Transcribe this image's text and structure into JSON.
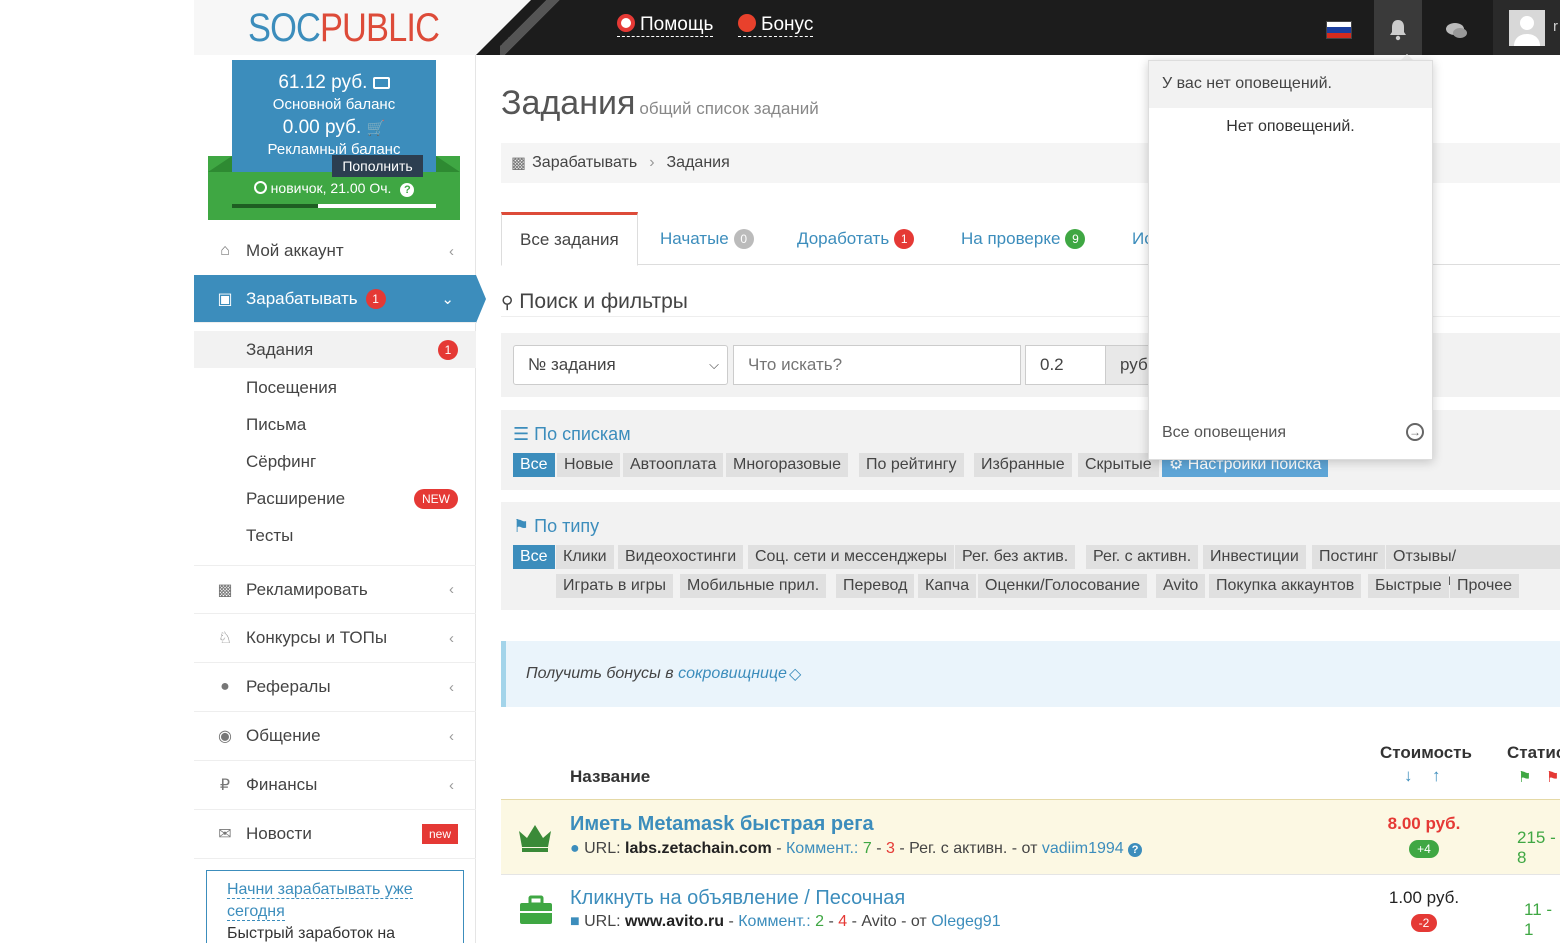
{
  "header": {
    "logo_left": "SOC",
    "logo_right": "PUBLIC",
    "help_label": "Помощь",
    "bonus_label": "Бонус",
    "user_initial": "r"
  },
  "balance": {
    "main_amount": "61.12 руб.",
    "main_label": "Основной баланс",
    "ad_amount": "0.00 руб.",
    "ad_label": "Рекламный баланс",
    "topup_label": "Пополнить",
    "level_text": "новичок, 21.00 Оч.",
    "level_progress": 0.42
  },
  "sidebar": {
    "account": "Мой аккаунт",
    "earn": "Зарабатывать",
    "earn_badge": "1",
    "sub": [
      {
        "label": "Задания",
        "badge": "1"
      },
      {
        "label": "Посещения"
      },
      {
        "label": "Письма"
      },
      {
        "label": "Сёрфинг"
      },
      {
        "label": "Расширение",
        "badge": "NEW"
      },
      {
        "label": "Тесты"
      }
    ],
    "advertise": "Рекламировать",
    "contests": "Конкурсы и ТОПы",
    "referrals": "Рефералы",
    "chat": "Общение",
    "finance": "Финансы",
    "news": "Новости",
    "news_badge": "new",
    "promo_link": "Начни зарабатывать уже сегодня",
    "promo_text": "Быстрый заработок на"
  },
  "page": {
    "title": "Задания",
    "subtitle": "общий список заданий",
    "crumb_1": "Зарабатывать",
    "crumb_2": "Задания"
  },
  "tabs": [
    {
      "label": "Все задания"
    },
    {
      "label": "Начатые",
      "count": "0"
    },
    {
      "label": "Доработать",
      "count": "1"
    },
    {
      "label": "На проверке",
      "count": "9"
    },
    {
      "label": "Ис"
    }
  ],
  "filters": {
    "title": "Поиск и фильтры",
    "select_value": "№ задания",
    "search_placeholder": "Что искать?",
    "min_price": "0.2",
    "currency": "руб",
    "lists_title": "По спискам",
    "lists": [
      "Все",
      "Новые",
      "Автооплата",
      "Многоразовые",
      "По рейтингу",
      "Избранные",
      "Скрытые",
      "Настройки поиска"
    ],
    "types_title": "По типу",
    "types_row1": [
      "Все",
      "Клики",
      "Видеохостинги",
      "Соц. сети и мессенджеры",
      "Рег. без актив.",
      "Рег. с активн.",
      "Инвестиции",
      "Постинг",
      "Отзывы/Комментарии"
    ],
    "types_row2": [
      "Играть в игры",
      "Мобильные прил.",
      "Перевод",
      "Капча",
      "Оценки/Голосование",
      "Avito",
      "Покупка аккаунтов",
      "Быстрые",
      "Прочее"
    ]
  },
  "callout": {
    "text": "Получить бонусы в",
    "link": "сокровищнице"
  },
  "table": {
    "col_name": "Название",
    "col_cost": "Стоимость",
    "col_stat": "Статис",
    "rows": [
      {
        "title": "Иметь Metamask быстрая рега",
        "url_label": "URL:",
        "url": "labs.zetachain.com",
        "comm_label": "Коммент.:",
        "comm_pos": "7",
        "dash": "-",
        "comm_neg": "3",
        "category": "- Рег. с активн. - от",
        "author": "vadiim1994",
        "price": "8.00 руб.",
        "delta": "+4",
        "stat": "215 - 8"
      },
      {
        "title": "Кликнуть на объявление / Песочная",
        "url_label": "URL:",
        "url": "www.avito.ru",
        "comm_label": "Коммент.:",
        "comm_pos": "2",
        "dash": "-",
        "comm_neg": "4",
        "category": "- Avito - от",
        "author": "Olegeg91",
        "price": "1.00 руб.",
        "delta": "-2",
        "stat": "11 - 1"
      }
    ]
  },
  "notifications": {
    "header": "У вас нет оповещений.",
    "empty": "Нет оповещений.",
    "all_link": "Все оповещения"
  },
  "colors": {
    "primary": "#3c8dbc",
    "danger": "#dd4b39",
    "success": "#3fa743",
    "topbar": "#1c1c1c"
  }
}
